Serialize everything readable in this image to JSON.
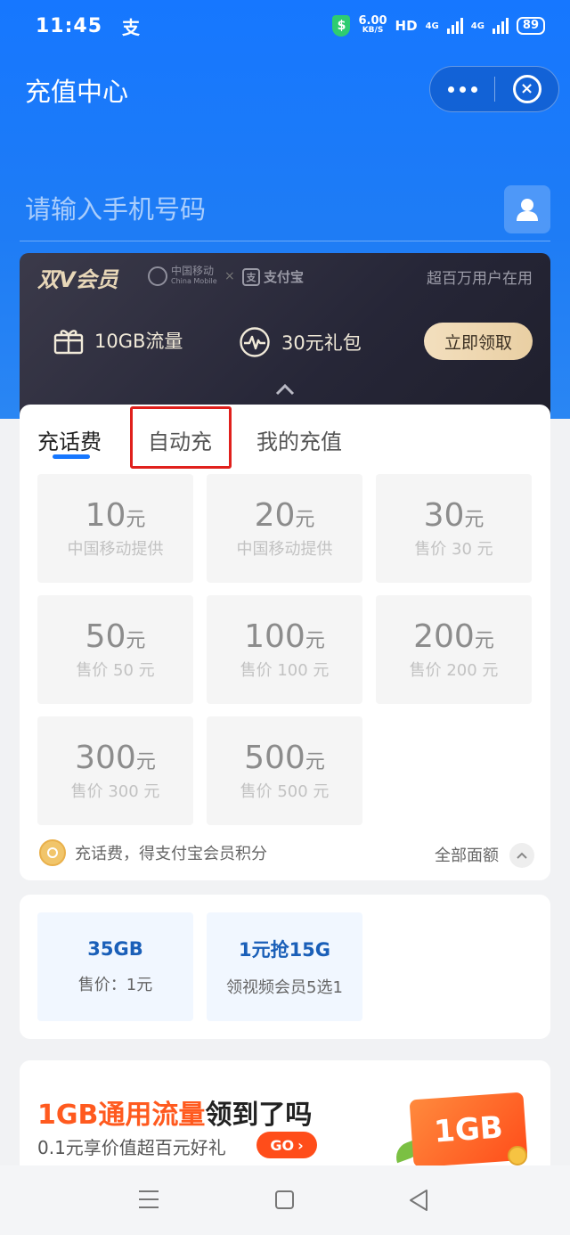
{
  "status_bar": {
    "time": "11:45",
    "alipay_glyph": "支",
    "net_speed": "6.00",
    "net_unit": "KB/S",
    "hd": "HD",
    "sim1": "4G",
    "sim2": "4G",
    "battery": "89"
  },
  "header": {
    "title": "充值中心",
    "more_icon": "more-dots-icon",
    "close_icon": "close-circle-icon"
  },
  "phone": {
    "placeholder": "请输入手机号码",
    "contact_icon": "contact-person-icon"
  },
  "vip": {
    "brand": "双V会员",
    "partner_cm": "中国移动",
    "partner_cm_en": "China Mobile",
    "partner_sep": "×",
    "partner_ali": "支付宝",
    "users": "超百万用户在用",
    "benefit_1": "10GB流量",
    "benefit_2": "30元礼包",
    "claim_button": "立即领取"
  },
  "tabs": [
    {
      "label": "充话费",
      "active": true
    },
    {
      "label": "自动充",
      "active": false,
      "highlighted": true
    },
    {
      "label": "我的充值",
      "active": false
    }
  ],
  "amounts": [
    {
      "value": "10",
      "unit": "元",
      "sub": "中国移动提供"
    },
    {
      "value": "20",
      "unit": "元",
      "sub": "中国移动提供"
    },
    {
      "value": "30",
      "unit": "元",
      "sub": "售价 30 元"
    },
    {
      "value": "50",
      "unit": "元",
      "sub": "售价 50 元"
    },
    {
      "value": "100",
      "unit": "元",
      "sub": "售价 100 元"
    },
    {
      "value": "200",
      "unit": "元",
      "sub": "售价 200 元"
    },
    {
      "value": "300",
      "unit": "元",
      "sub": "售价 300 元"
    },
    {
      "value": "500",
      "unit": "元",
      "sub": "售价 500 元"
    }
  ],
  "points": {
    "text": "充话费，得支付宝会员积分",
    "all_denominations": "全部面额"
  },
  "data_packages": [
    {
      "title": "35GB",
      "sub": "售价：1元"
    },
    {
      "title": "1元抢15G",
      "sub": "领视频会员5选1"
    }
  ],
  "promo": {
    "headline_orange": "1GB通用流量",
    "headline_black": "领到了吗",
    "sub": "0.1元享价值超百元好礼",
    "go": "GO",
    "ticket": "1GB"
  },
  "colors": {
    "brand_blue": "#1677ff",
    "highlight_red": "#e0201c",
    "promo_orange": "#ff5a1f"
  }
}
